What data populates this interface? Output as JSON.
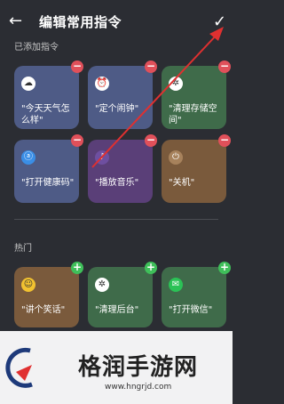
{
  "header": {
    "title": "编辑常用指令",
    "back_icon": "back-arrow-icon",
    "confirm_icon": "checkmark-icon"
  },
  "added_section": {
    "title": "已添加指令",
    "items": [
      {
        "label": "\"今天天气怎么样\"",
        "icon": "weather-icon",
        "color": "#4e5b86"
      },
      {
        "label": "\"定个闹钟\"",
        "icon": "alarm-icon",
        "color": "#4e5b86"
      },
      {
        "label": "\"清理存储空间\"",
        "icon": "cleanup-icon",
        "color": "#3f6b4a"
      },
      {
        "label": "\"打开健康码\"",
        "icon": "health-code-icon",
        "color": "#4e5b86"
      },
      {
        "label": "\"播放音乐\"",
        "icon": "music-icon",
        "color": "#5a3f78"
      },
      {
        "label": "\"关机\"",
        "icon": "power-icon",
        "color": "#7a5a3c"
      }
    ]
  },
  "hot_section": {
    "title": "热门",
    "items": [
      {
        "label": "\"讲个笑话\"",
        "icon": "joke-icon",
        "color": "#7a5a3c"
      },
      {
        "label": "\"清理后台\"",
        "icon": "clean-background-icon",
        "color": "#3f6b4a"
      },
      {
        "label": "\"打开微信\"",
        "icon": "wechat-icon",
        "color": "#3f6b4a"
      }
    ]
  },
  "watermark": {
    "text": "格润手游网",
    "url": "www.hngrjd.com"
  },
  "colors": {
    "remove": "#e0505a",
    "add": "#3fbf5a",
    "arrow": "#e03030"
  }
}
